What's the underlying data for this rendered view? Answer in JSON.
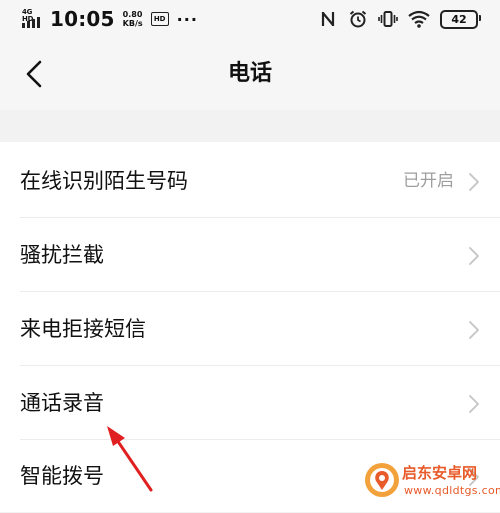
{
  "status_bar": {
    "network": "4G HD",
    "time": "10:05",
    "speed_value": "0.80",
    "speed_unit": "KB/s",
    "hd_badge": "HD",
    "more": "···",
    "battery": "42",
    "icons": [
      "signal-icon",
      "hd-icon",
      "nfc-icon",
      "alarm-icon",
      "vibrate-icon",
      "wifi-icon",
      "battery-icon"
    ]
  },
  "header": {
    "title": "电话",
    "back_icon": "chevron-left-icon"
  },
  "settings": {
    "items": [
      {
        "label": "在线识别陌生号码",
        "value": "已开启"
      },
      {
        "label": "骚扰拦截",
        "value": ""
      },
      {
        "label": "来电拒接短信",
        "value": ""
      },
      {
        "label": "通话录音",
        "value": ""
      },
      {
        "label": "智能拨号",
        "value": ""
      }
    ]
  },
  "watermark": {
    "main": "启东安卓网",
    "sub": "www.qdldtgs.com"
  },
  "colors": {
    "background": "#f2f2f2",
    "header_bg": "#f6f6f6",
    "list_bg": "#ffffff",
    "secondary_text": "#9e9e9e",
    "arrow": "#e02020",
    "watermark": "#e85b2a"
  }
}
